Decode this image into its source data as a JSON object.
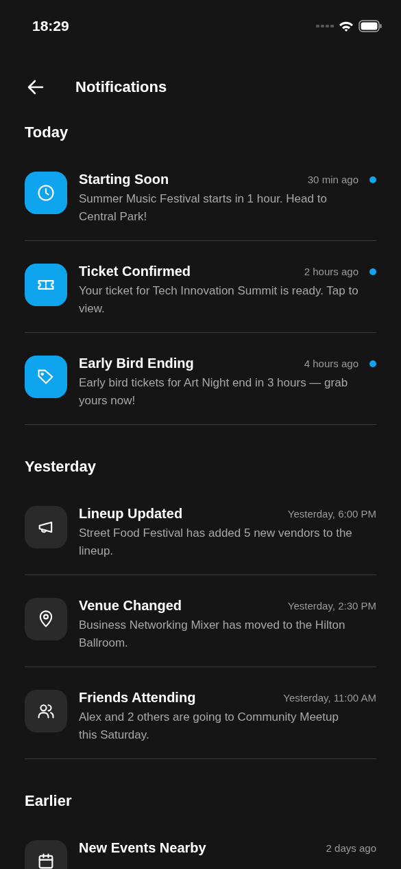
{
  "status_bar": {
    "time": "18:29"
  },
  "header": {
    "title": "Notifications"
  },
  "sections": [
    {
      "title": "Today",
      "items": [
        {
          "kind": "clock",
          "title": "Starting Soon",
          "time": "30 min ago",
          "message": "Summer Music Festival starts in 1 hour. Head to Central Park!",
          "unread": true
        },
        {
          "kind": "ticket",
          "title": "Ticket Confirmed",
          "time": "2 hours ago",
          "message": "Your ticket for Tech Innovation Summit is ready. Tap to view.",
          "unread": true
        },
        {
          "kind": "tag",
          "title": "Early Bird Ending",
          "time": "4 hours ago",
          "message": "Early bird tickets for Art Night end in 3 hours — grab yours now!",
          "unread": true
        }
      ]
    },
    {
      "title": "Yesterday",
      "items": [
        {
          "kind": "megaphone",
          "title": "Lineup Updated",
          "time": "Yesterday, 6:00 PM",
          "message": "Street Food Festival has added 5 new vendors to the lineup.",
          "unread": false
        },
        {
          "kind": "pin",
          "title": "Venue Changed",
          "time": "Yesterday, 2:30 PM",
          "message": "Business Networking Mixer has moved to the Hilton Ballroom.",
          "unread": false
        },
        {
          "kind": "users",
          "title": "Friends Attending",
          "time": "Yesterday, 11:00 AM",
          "message": "Alex and 2 others are going to Community Meetup this Saturday.",
          "unread": false
        }
      ]
    },
    {
      "title": "Earlier",
      "items": [
        {
          "kind": "calendar",
          "title": "New Events Nearby",
          "time": "2 days ago",
          "unread": false
        }
      ]
    }
  ]
}
